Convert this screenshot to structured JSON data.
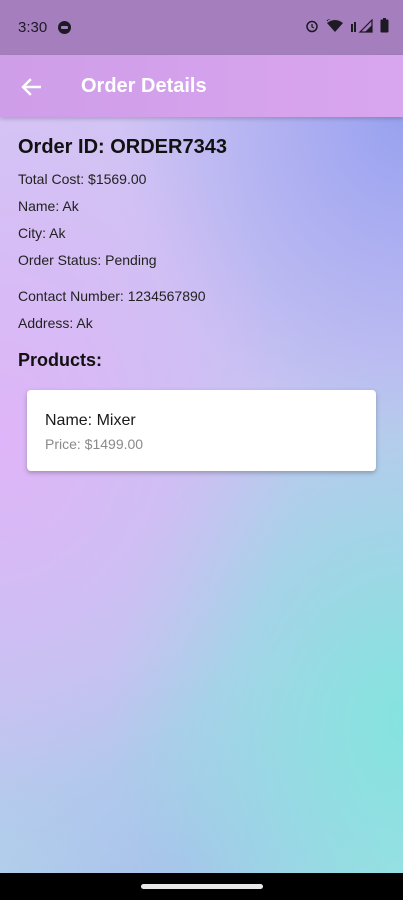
{
  "status_bar": {
    "time": "3:30",
    "icons": [
      "notification-icon",
      "alarm-icon",
      "wifi-icon",
      "signal-icon",
      "battery-icon"
    ]
  },
  "app_bar": {
    "title": "Order Details",
    "back_icon": "arrow-back-icon"
  },
  "order": {
    "id_line": "Order ID: ORDER7343",
    "total_cost": "Total Cost: $1569.00",
    "name": "Name: Ak",
    "city": "City: Ak",
    "status": "Order Status: Pending",
    "contact": "Contact Number: 1234567890",
    "address": "Address: Ak"
  },
  "products": {
    "title": "Products:",
    "items": [
      {
        "name": "Name: Mixer",
        "price": "Price: $1499.00"
      }
    ]
  },
  "colors": {
    "status_bar": "#a57fbd",
    "app_bar": "#d5a2ec",
    "card_bg": "#ffffff"
  }
}
